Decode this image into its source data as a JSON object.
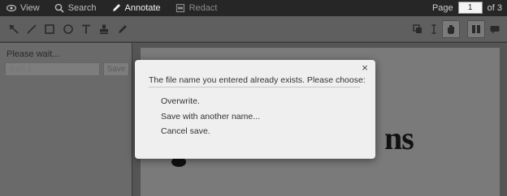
{
  "menu": {
    "view": "View",
    "search": "Search",
    "annotate": "Annotate",
    "redact": "Redact"
  },
  "pager": {
    "label": "Page",
    "current": "1",
    "total": "of 3"
  },
  "toolbar": {
    "left_icons": [
      "select-arrow-icon",
      "line-icon",
      "rectangle-icon",
      "ellipse-icon",
      "text-icon",
      "stamp-icon",
      "pen-icon"
    ],
    "right_icons": [
      "copy-icon",
      "text-cursor-icon",
      "hand-icon",
      "columns-icon",
      "comment-icon"
    ]
  },
  "left_panel": {
    "status": "Please wait...",
    "name_placeholder": "draft 1",
    "save_label": "Save"
  },
  "document": {
    "visible_text": "ns"
  },
  "dialog": {
    "message": "The file name you entered already exists. Please choose:",
    "close": "×",
    "options": [
      "Overwrite.",
      "Save with another name...",
      "Cancel save."
    ]
  }
}
